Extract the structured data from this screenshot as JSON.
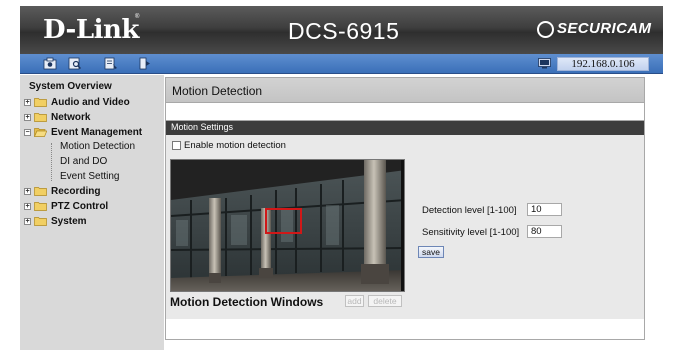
{
  "header": {
    "logo": "D-Link",
    "model": "DCS-6915",
    "brand": "SECURICAM"
  },
  "toolbar": {
    "icons": [
      "camera-icon",
      "setup-icon",
      "maintenance-icon",
      "logout-icon"
    ],
    "ip_address": "192.168.0.106"
  },
  "sidebar": {
    "title": "System Overview",
    "items": [
      {
        "label": "Audio and Video",
        "expanded": false
      },
      {
        "label": "Network",
        "expanded": false
      },
      {
        "label": "Event Management",
        "expanded": true,
        "children": [
          "Motion Detection",
          "DI and DO",
          "Event Setting"
        ]
      },
      {
        "label": "Recording",
        "expanded": false
      },
      {
        "label": "PTZ Control",
        "expanded": false
      },
      {
        "label": "System",
        "expanded": false
      }
    ]
  },
  "main": {
    "page_title": "Motion Detection",
    "settings_title": "Motion Settings",
    "enable_label": "Enable motion detection",
    "enable_checked": false,
    "windows_label": "Motion Detection Windows",
    "add_label": "add",
    "delete_label": "delete",
    "detection_label": "Detection level [1-100]",
    "detection_value": "10",
    "sensitivity_label": "Sensitivity level [1-100]",
    "sensitivity_value": "80",
    "save_label": "save"
  },
  "colors": {
    "header_bg": "#3e3e3e",
    "toolbar_bg": "#4a7ec4",
    "sidebar_bg": "#d9d9d9",
    "settings_header_bg": "#3d3d3d",
    "md_window_border": "#d01818"
  }
}
